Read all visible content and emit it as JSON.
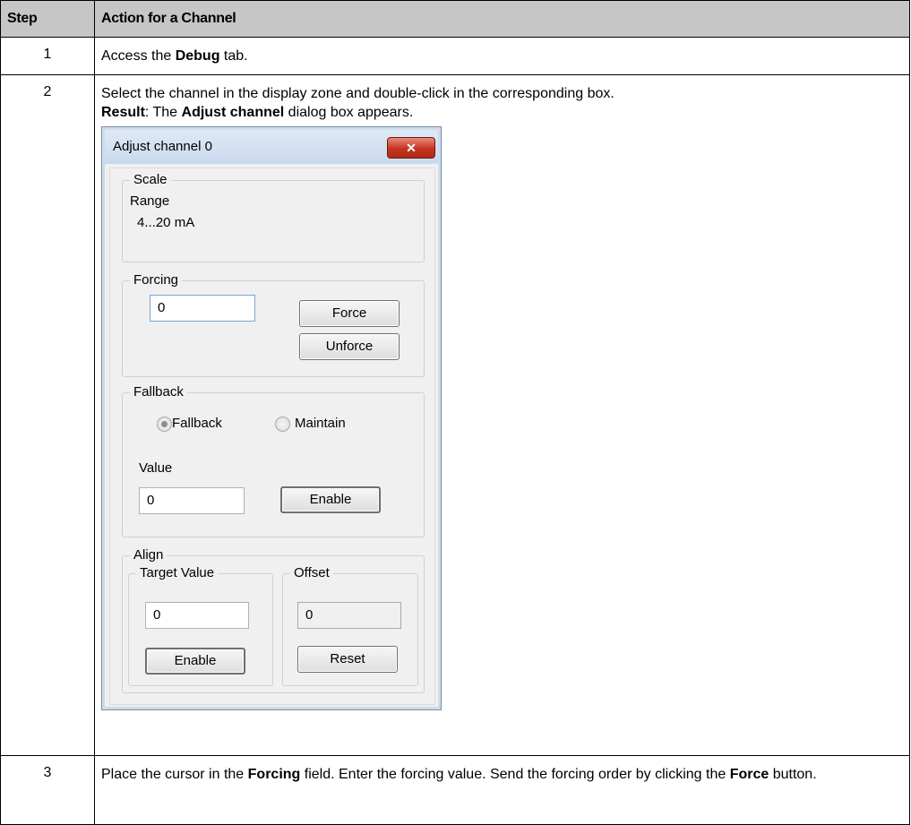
{
  "table": {
    "headers": {
      "step": "Step",
      "action": "Action for a Channel"
    },
    "rows": [
      {
        "step": "1",
        "text": {
          "pre": "Access the ",
          "bold": "Debug",
          "post": " tab."
        }
      },
      {
        "step": "2",
        "line1": "Select the channel in the display zone and double-click in the corresponding box.",
        "line2": {
          "bold1": "Result",
          "mid": ": The ",
          "bold2": "Adjust channel",
          "post": " dialog box appears."
        }
      },
      {
        "step": "3",
        "text": {
          "pre": "Place the cursor in the ",
          "bold1": "Forcing",
          "mid": " field. Enter the forcing value. Send the forcing order by clicking the ",
          "bold2": "Force",
          "post": " button."
        }
      }
    ]
  },
  "dialog": {
    "title": "Adjust channel 0",
    "close_glyph": "✕",
    "scale": {
      "legend": "Scale",
      "range_label": "Range",
      "range_value": "4...20 mA"
    },
    "forcing": {
      "legend": "Forcing",
      "value": "0",
      "force_label": "Force",
      "unforce_label": "Unforce"
    },
    "fallback": {
      "legend": "Fallback",
      "radio_fallback": "Fallback",
      "radio_maintain": "Maintain",
      "selected": "Fallback",
      "value_label": "Value",
      "value": "0",
      "enable_label": "Enable"
    },
    "align": {
      "legend": "Align",
      "target": {
        "legend": "Target Value",
        "value": "0",
        "enable_label": "Enable"
      },
      "offset": {
        "legend": "Offset",
        "value": "0",
        "reset_label": "Reset"
      }
    }
  }
}
